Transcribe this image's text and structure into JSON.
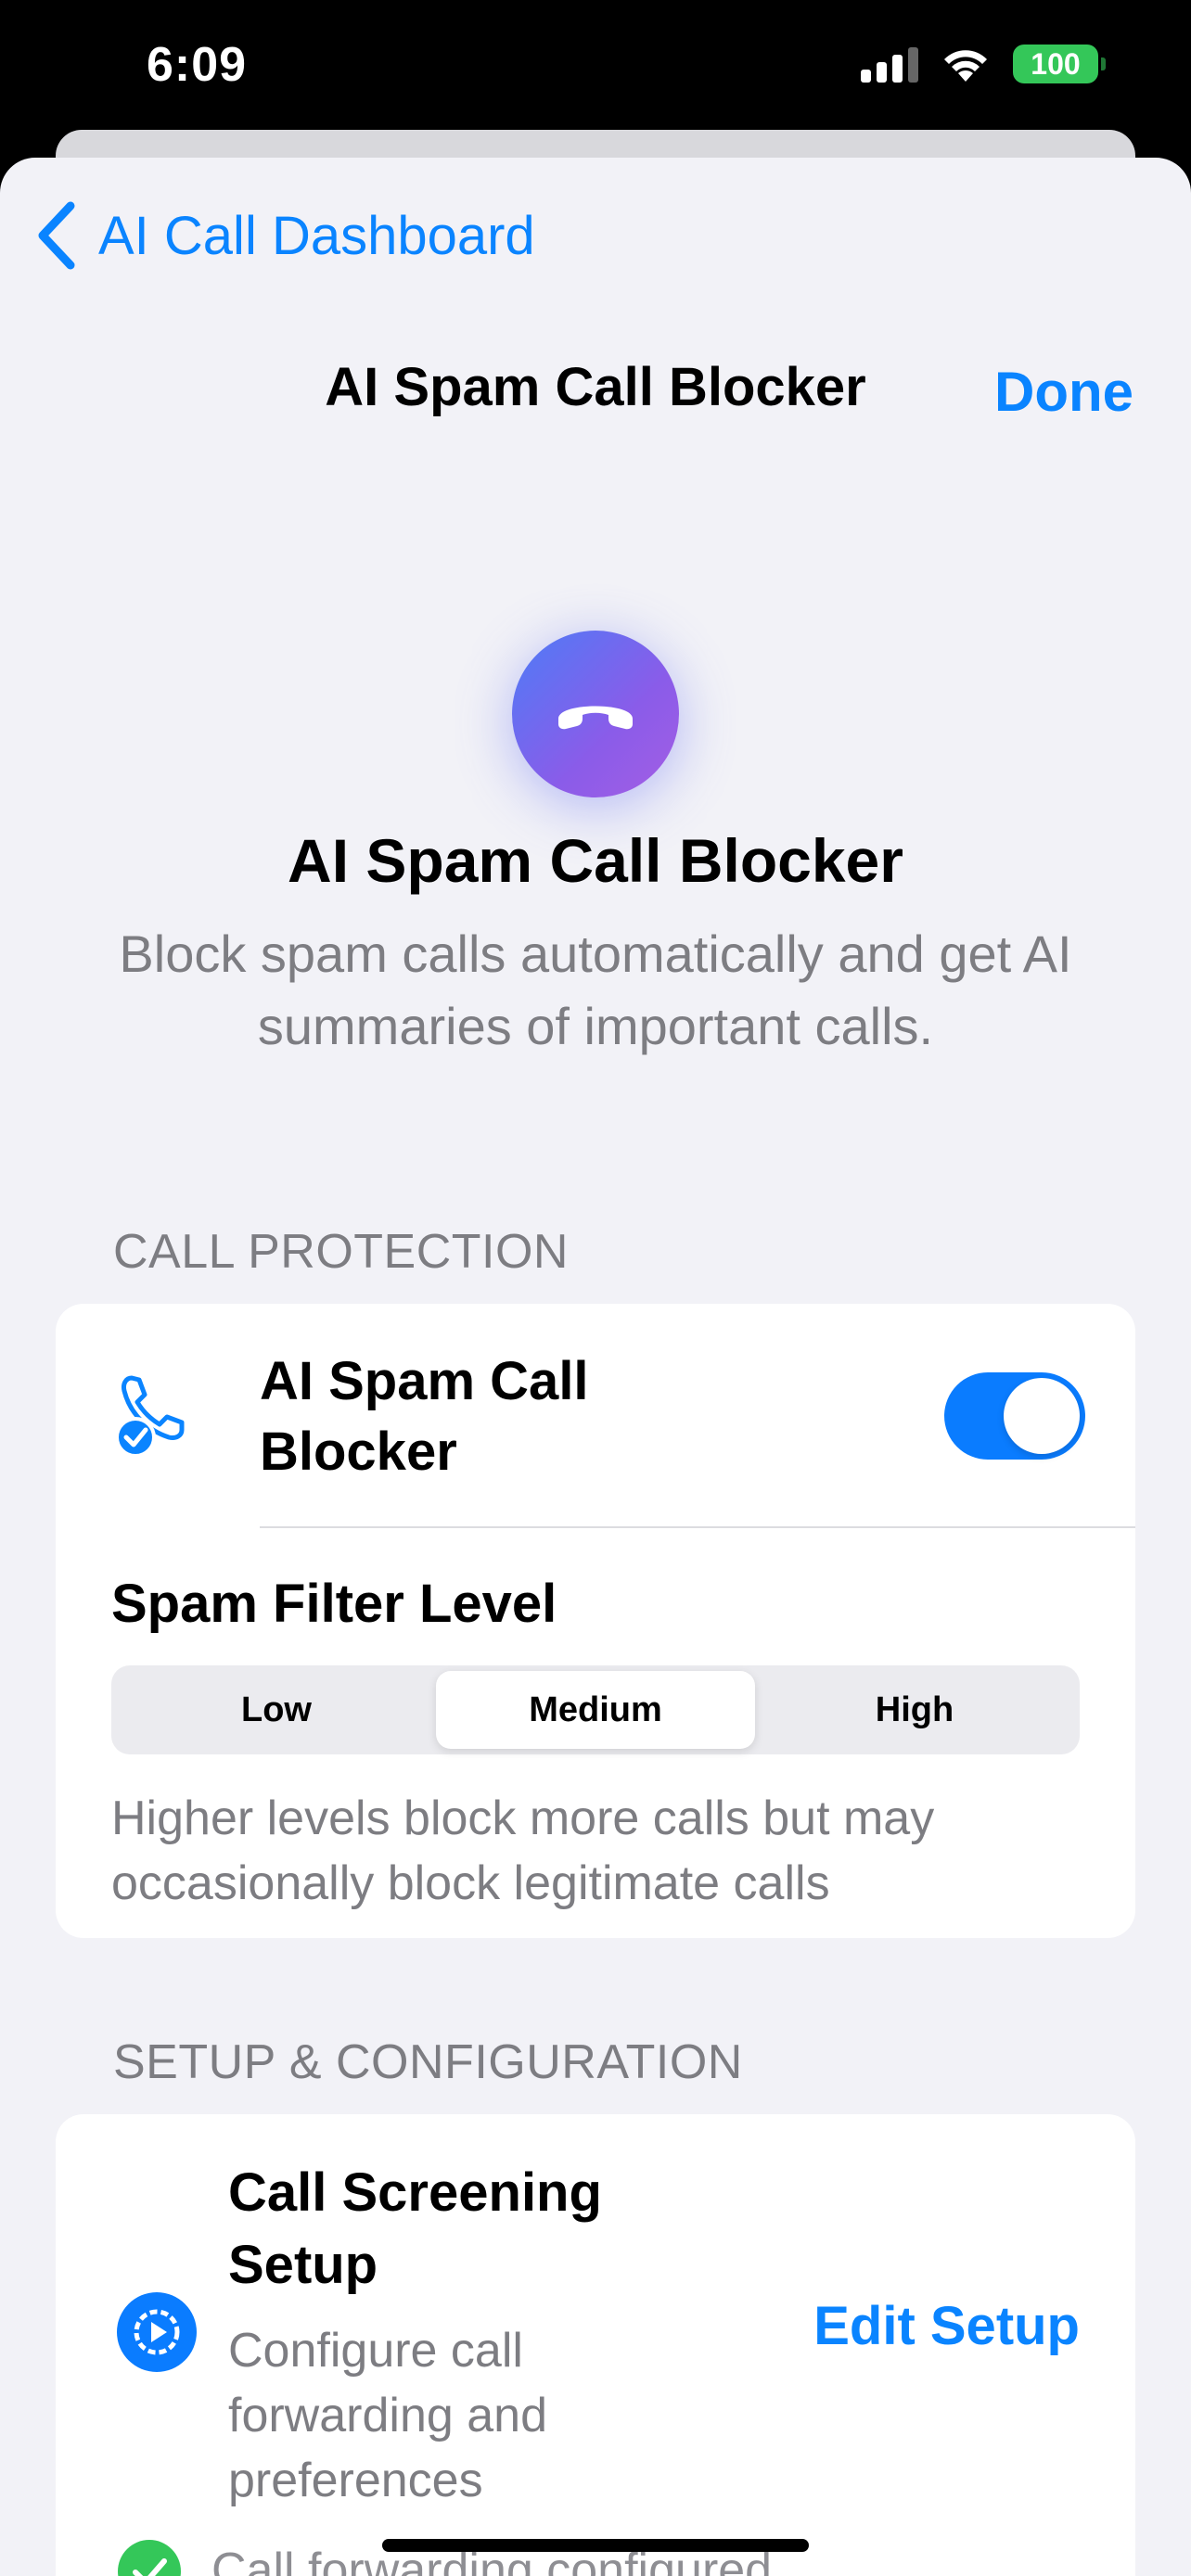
{
  "status_bar": {
    "time": "6:09",
    "battery": "100"
  },
  "nav": {
    "back_label": "AI Call Dashboard",
    "title": "AI Spam Call Blocker",
    "done_label": "Done"
  },
  "hero": {
    "icon": "phone-hangup-icon",
    "title": "AI Spam Call Blocker",
    "description": "Block spam calls automatically and get AI summaries of important calls."
  },
  "call_protection": {
    "header": "CALL PROTECTION",
    "blocker": {
      "icon": "phone-check-icon",
      "label": "AI Spam Call Blocker",
      "enabled": true
    },
    "filter": {
      "title": "Spam Filter Level",
      "options": [
        "Low",
        "Medium",
        "High"
      ],
      "selected": "Medium",
      "note": "Higher levels block more calls but may occasionally block legitimate calls"
    }
  },
  "setup": {
    "header": "SETUP & CONFIGURATION",
    "screening": {
      "icon": "gear-play-icon",
      "title": "Call Screening Setup",
      "description": "Configure call forwarding and preferences",
      "action_label": "Edit Setup"
    },
    "status": {
      "icon": "checkmark-circle-icon",
      "label": "Call forwarding configured"
    }
  },
  "colors": {
    "accent": "#0a84ff",
    "toggle_on": "#0a7cff",
    "battery": "#34c759",
    "background": "#f2f2f7"
  }
}
